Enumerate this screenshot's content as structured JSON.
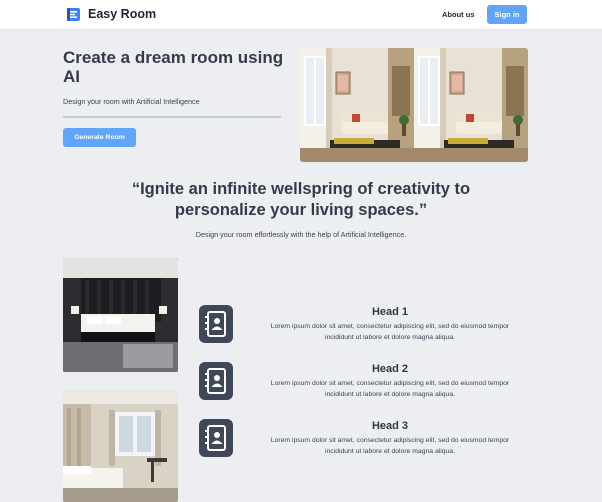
{
  "header": {
    "brand": "Easy Room",
    "about_label": "About us",
    "signin_label": "Sign in"
  },
  "hero": {
    "title": "Create a dream room using AI",
    "subtitle": "Design your room with Artificial Intelligence",
    "cta_label": "Generate Room"
  },
  "quote": {
    "text": "“Ignite an infinite wellspring of creativity to personalize your living spaces.”",
    "subtitle": "Design your room effortlessly with the help of Artificial Intelligence."
  },
  "features": [
    {
      "head": "Head 1",
      "body": "Lorem ipsum dolor sit amet, consectetur adipiscing elit, sed do eiusmod tempor incididunt ut labore et dolore magna aliqua.",
      "icon": "contact-book-icon"
    },
    {
      "head": "Head 2",
      "body": "Lorem ipsum dolor sit amet, consectetur adipiscing elit, sed do eiusmod tempor incididunt ut labore et dolore magna aliqua.",
      "icon": "contact-book-icon"
    },
    {
      "head": "Head 3",
      "body": "Lorem ipsum dolor sit amet, consectetur adipiscing elit, sed do eiusmod tempor incididunt ut labore et dolore magna aliqua.",
      "icon": "contact-book-icon"
    }
  ],
  "colors": {
    "accent": "#60a5fa",
    "text_dark": "#333b4a",
    "icon_bg": "#3f4859",
    "page_bg": "#eceef2"
  }
}
